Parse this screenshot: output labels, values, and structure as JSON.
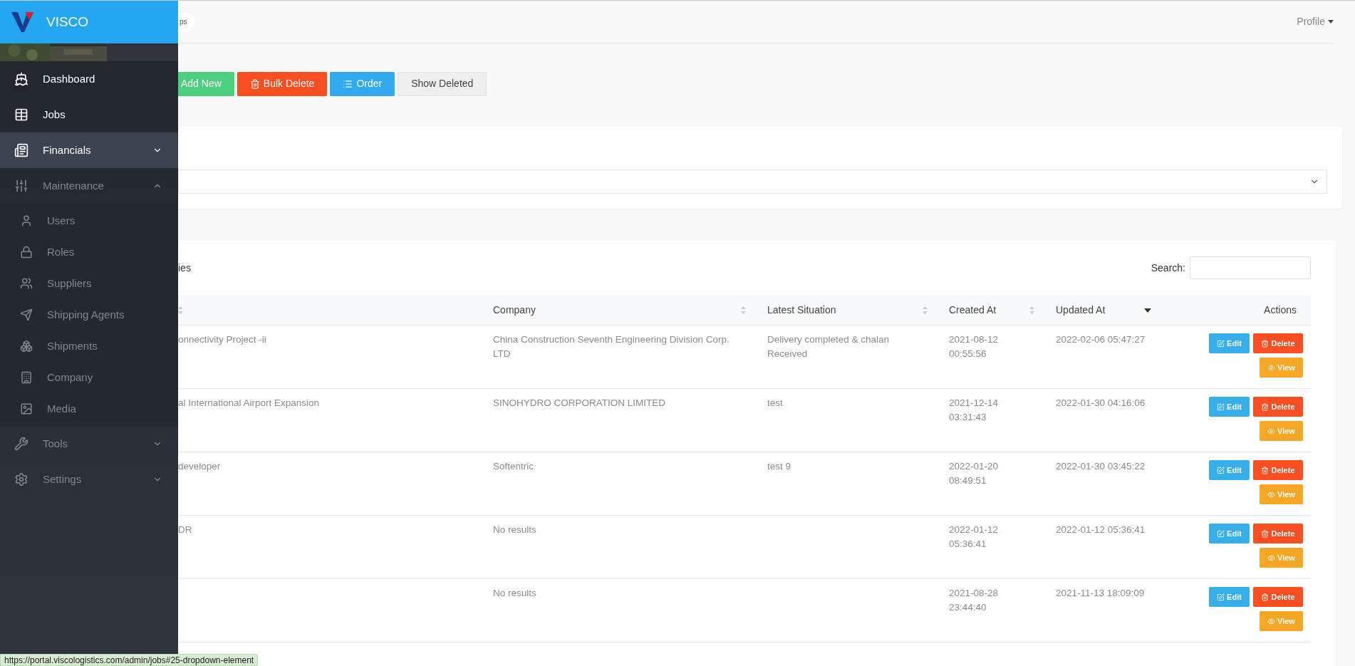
{
  "brand": {
    "name": "VISCO"
  },
  "sidebar": {
    "items": [
      {
        "kind": "link",
        "label": "Dashboard",
        "dimmed": false,
        "selected": false
      },
      {
        "kind": "link",
        "label": "Jobs",
        "dimmed": false,
        "selected": false
      },
      {
        "kind": "group",
        "label": "Financials",
        "dimmed": false,
        "selected": true,
        "expanded": false
      },
      {
        "kind": "group",
        "label": "Maintenance",
        "dimmed": true,
        "selected": false,
        "expanded": true,
        "children": [
          {
            "label": "Users"
          },
          {
            "label": "Roles"
          },
          {
            "label": "Suppliers"
          },
          {
            "label": "Shipping Agents"
          },
          {
            "label": "Shipments"
          },
          {
            "label": "Company"
          },
          {
            "label": "Media"
          }
        ]
      },
      {
        "kind": "group",
        "label": "Tools",
        "dimmed": true,
        "selected": false,
        "expanded": false
      },
      {
        "kind": "group",
        "label": "Settings",
        "dimmed": true,
        "selected": false,
        "expanded": false
      }
    ]
  },
  "header": {
    "breadcrumb": "ps",
    "profile": "Profile"
  },
  "toolbar": [
    {
      "kind": "add",
      "label": "Add New"
    },
    {
      "kind": "delete",
      "label": "Bulk Delete"
    },
    {
      "kind": "order",
      "label": "Order"
    },
    {
      "kind": "plain",
      "label": "Show Deleted"
    }
  ],
  "table_card": {
    "length_text": "ies",
    "search_label": "Search:"
  },
  "table": {
    "columns": [
      {
        "sorted": false
      },
      {
        "label": "Company",
        "sorted": false
      },
      {
        "label": "Latest Situation",
        "sorted": false
      },
      {
        "label": "Created At",
        "sorted": false
      },
      {
        "label": "Updated At",
        "sorted": true
      },
      {
        "label": "Actions"
      }
    ],
    "rows": [
      {
        "column_1": "onnectivity Project -ii",
        "company": "China Construction Seventh Engineering Division Corp. LTD",
        "latest_situation": "Delivery completed & chalan Received",
        "created_at": "2021-08-12 00:55:56",
        "updated_at": "2022-02-06 05:47:27",
        "actions": [
          {
            "kind": "edit",
            "label": "Edit"
          },
          {
            "kind": "delete",
            "label": "Delete"
          },
          {
            "kind": "view",
            "label": "View"
          }
        ]
      },
      {
        "column_1": "al International Airport Expansion",
        "company": "SINOHYDRO CORPORATION LIMITED",
        "latest_situation": "test",
        "created_at": "2021-12-14 03:31:43",
        "updated_at": "2022-01-30 04:16:06",
        "actions": [
          {
            "kind": "edit",
            "label": "Edit"
          },
          {
            "kind": "delete",
            "label": "Delete"
          },
          {
            "kind": "view",
            "label": "View"
          }
        ]
      },
      {
        "column_1": "developer",
        "company": "Softentric",
        "latest_situation": "test 9",
        "created_at": "2022-01-20 08:49:51",
        "updated_at": "2022-01-30 03:45:22",
        "actions": [
          {
            "kind": "edit",
            "label": "Edit"
          },
          {
            "kind": "delete",
            "label": "Delete"
          },
          {
            "kind": "view",
            "label": "View"
          }
        ]
      },
      {
        "column_1": "DR",
        "company": "No results",
        "created_at": "2022-01-12 05:36:41",
        "updated_at": "2022-01-12 05:36:41",
        "actions": [
          {
            "kind": "edit",
            "label": "Edit"
          },
          {
            "kind": "delete",
            "label": "Delete"
          },
          {
            "kind": "view",
            "label": "View"
          }
        ]
      },
      {
        "company": "No results",
        "created_at": "2021-08-28 23:44:40",
        "updated_at": "2021-11-13 18:09:09",
        "actions": [
          {
            "kind": "edit",
            "label": "Edit"
          },
          {
            "kind": "delete",
            "label": "Delete"
          },
          {
            "kind": "view",
            "label": "View"
          }
        ]
      }
    ]
  },
  "status_bar": {
    "url": "https://portal.viscologistics.com/admin/jobs#25-dropdown-element"
  }
}
